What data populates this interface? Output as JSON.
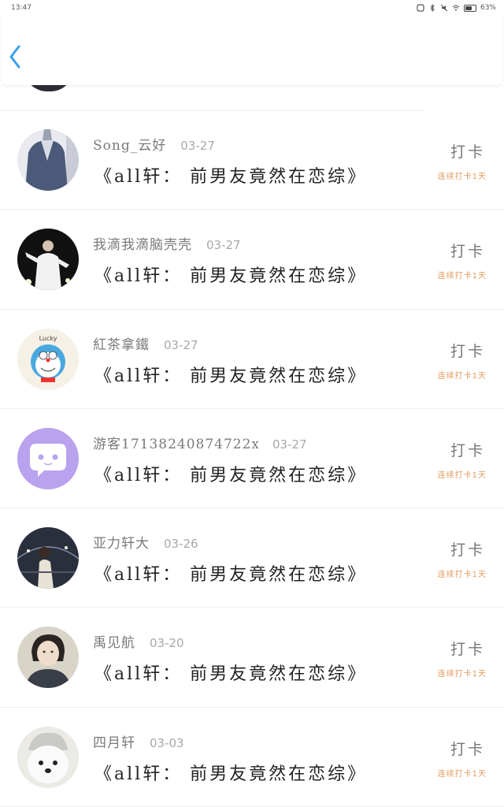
{
  "status_bar": {
    "time": "13:47",
    "battery": "63%",
    "battery_level": 0.63
  },
  "header": {
    "back_icon": "chevron-left-icon"
  },
  "colors": {
    "accent_blue": "#3a9fe8",
    "streak_orange": "#e09a5c"
  },
  "items": [
    {
      "name": "Song_云好",
      "date": "03-27",
      "title": "《all轩： 前男友竟然在恋综》",
      "checkin": "打卡",
      "streak": "连续打卡1天",
      "avatar": "avatar-jacket"
    },
    {
      "name": "我滴我滴脑壳壳",
      "date": "03-27",
      "title": "《all轩： 前男友竟然在恋综》",
      "checkin": "打卡",
      "streak": "连续打卡1天",
      "avatar": "avatar-stage"
    },
    {
      "name": "紅茶拿鐵",
      "date": "03-27",
      "title": "《all轩： 前男友竟然在恋综》",
      "checkin": "打卡",
      "streak": "连续打卡1天",
      "avatar": "avatar-doraemon",
      "avatar_text": "Lucky"
    },
    {
      "name": "游客17138240874722x…",
      "date": "03-27",
      "title": "《all轩： 前男友竟然在恋综》",
      "checkin": "打卡",
      "streak": "连续打卡1天",
      "avatar": "avatar-default"
    },
    {
      "name": "亚力轩大",
      "date": "03-26",
      "title": "《all轩： 前男友竟然在恋综》",
      "checkin": "打卡",
      "streak": "连续打卡1天",
      "avatar": "avatar-night"
    },
    {
      "name": "禹见航",
      "date": "03-20",
      "title": "《all轩： 前男友竟然在恋综》",
      "checkin": "打卡",
      "streak": "连续打卡1天",
      "avatar": "avatar-girl"
    },
    {
      "name": "四月轩",
      "date": "03-03",
      "title": "《all轩： 前男友竟然在恋综》",
      "checkin": "打卡",
      "streak": "连续打卡1天",
      "avatar": "avatar-dog"
    }
  ]
}
